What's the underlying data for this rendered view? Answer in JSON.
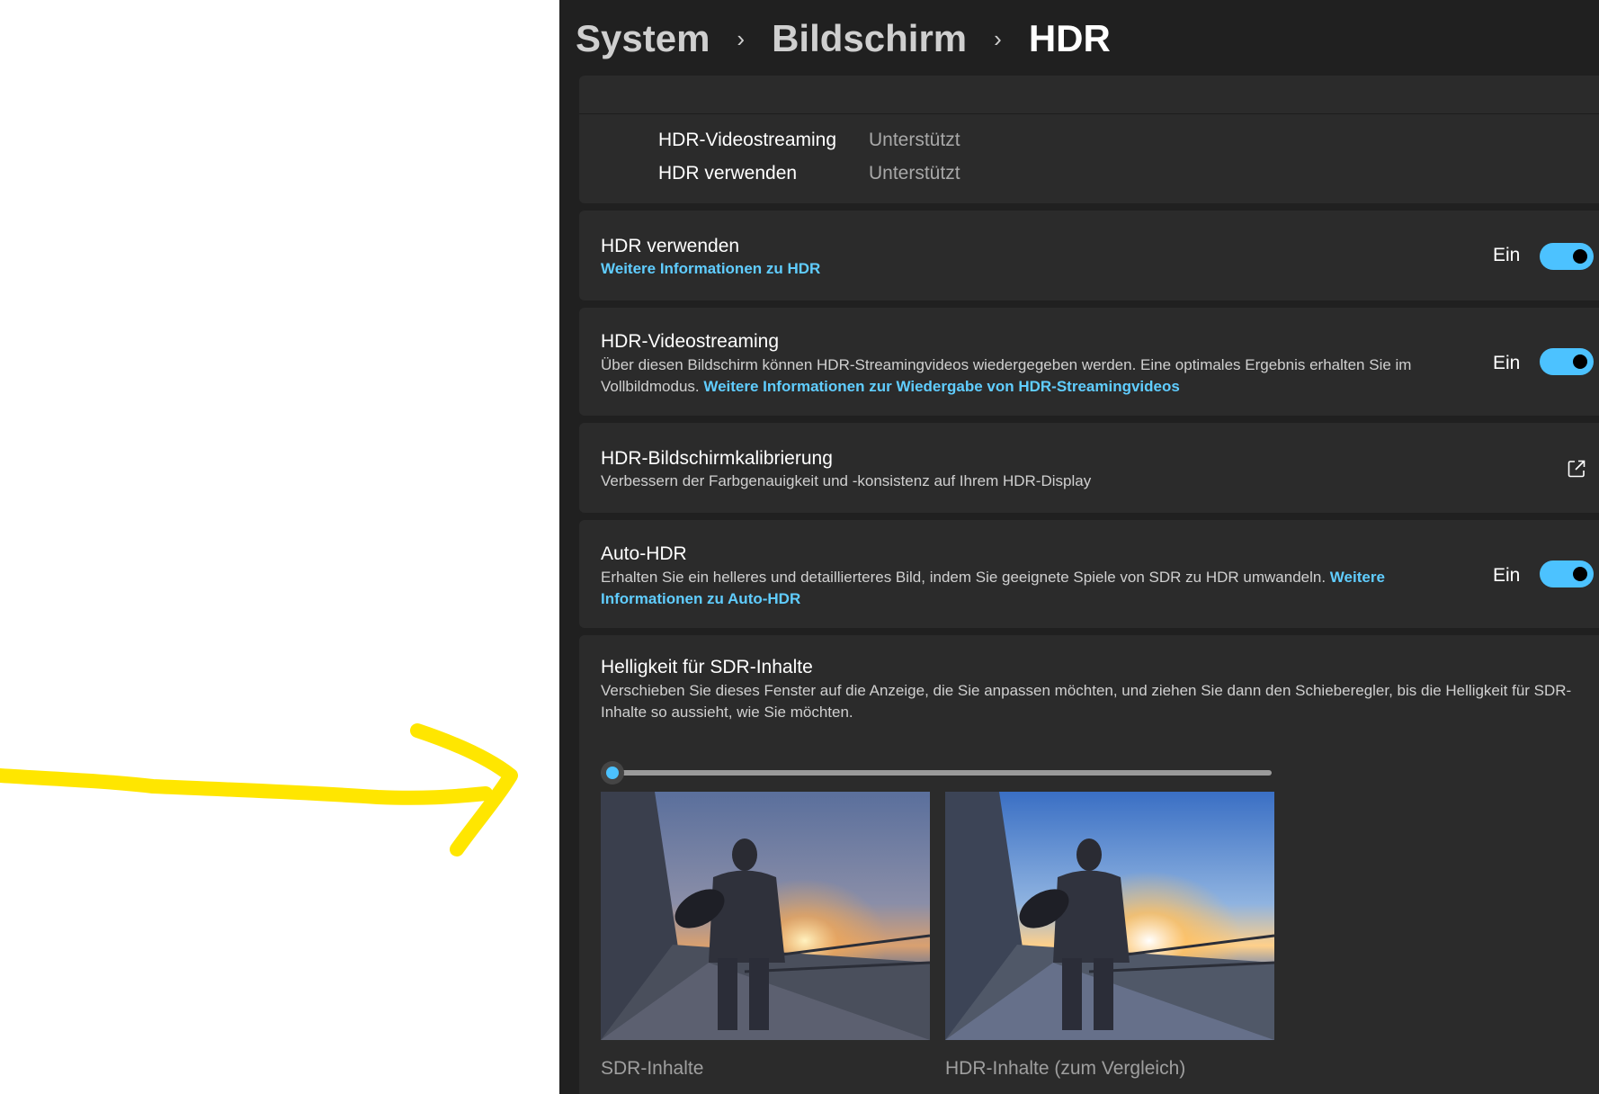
{
  "breadcrumb": {
    "level1": "System",
    "level2": "Bildschirm",
    "current": "HDR",
    "separator": "›"
  },
  "display_info": {
    "rows": [
      {
        "label": "HDR-Videostreaming",
        "value": "Unterstützt"
      },
      {
        "label": "HDR verwenden",
        "value": "Unterstützt"
      }
    ]
  },
  "settings": {
    "use_hdr": {
      "title": "HDR verwenden",
      "link": "Weitere Informationen zu HDR",
      "state": "Ein",
      "on": true
    },
    "video_streaming": {
      "title": "HDR-Videostreaming",
      "desc": "Über diesen Bildschirm können HDR-Streamingvideos wiedergegeben werden. Eine optimales Ergebnis erhalten Sie im Vollbildmodus.",
      "link": "Weitere Informationen zur Wiedergabe von HDR-Streamingvideos",
      "state": "Ein",
      "on": true
    },
    "calibration": {
      "title": "HDR-Bildschirmkalibrierung",
      "desc": "Verbessern der Farbgenauigkeit und -konsistenz auf Ihrem HDR-Display",
      "icon": "external-link-icon"
    },
    "auto_hdr": {
      "title": "Auto-HDR",
      "desc": "Erhalten Sie ein helleres und detaillierteres Bild, indem Sie geeignete Spiele von SDR zu HDR umwandeln.",
      "link": "Weitere Informationen zu Auto-HDR",
      "state": "Ein",
      "on": true
    },
    "sdr_brightness": {
      "title": "Helligkeit für SDR-Inhalte",
      "desc": "Verschieben Sie dieses Fenster auf die Anzeige, die Sie anpassen möchten, und ziehen Sie dann den Schieberegler, bis die Helligkeit für SDR-Inhalte so aussieht, wie Sie möchten.",
      "slider_value_fraction": 0.0,
      "caption_sdr": "SDR-Inhalte",
      "caption_hdr": "HDR-Inhalte (zum Vergleich)"
    }
  },
  "colors": {
    "accent": "#4cc2ff",
    "link": "#60cdff",
    "window_bg": "#202020",
    "card_bg": "#2b2b2b",
    "annotation_arrow": "#ffe600"
  }
}
